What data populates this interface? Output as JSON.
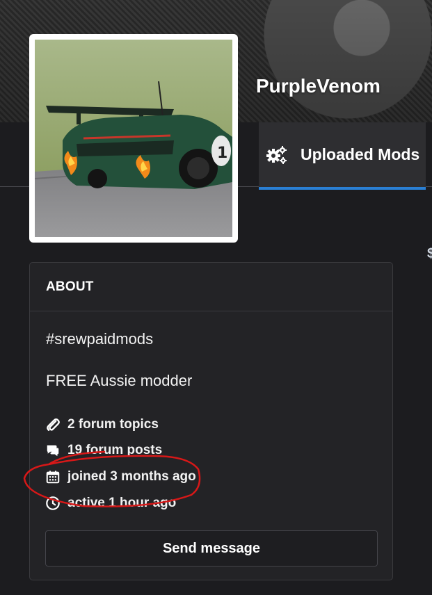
{
  "profile": {
    "username": "PurpleVenom"
  },
  "tabs": [
    {
      "label": "Uploaded Mods",
      "icon": "gears-icon",
      "active": true
    }
  ],
  "about": {
    "heading": "ABOUT",
    "bio_lines": [
      "#srewpaidmods",
      "FREE Aussie modder"
    ],
    "stats": [
      {
        "icon": "paperclip-icon",
        "text": "2 forum topics"
      },
      {
        "icon": "speech-bubbles-icon",
        "text": "19 forum posts"
      },
      {
        "icon": "calendar-icon",
        "text": "joined 3 months ago"
      },
      {
        "icon": "clock-icon",
        "text": "active 1 hour ago"
      }
    ],
    "send_button": "Send message"
  },
  "colors": {
    "active_tab_underline": "#2a7fd4",
    "annotation": "#d81818",
    "background": "#1c1c1f"
  }
}
